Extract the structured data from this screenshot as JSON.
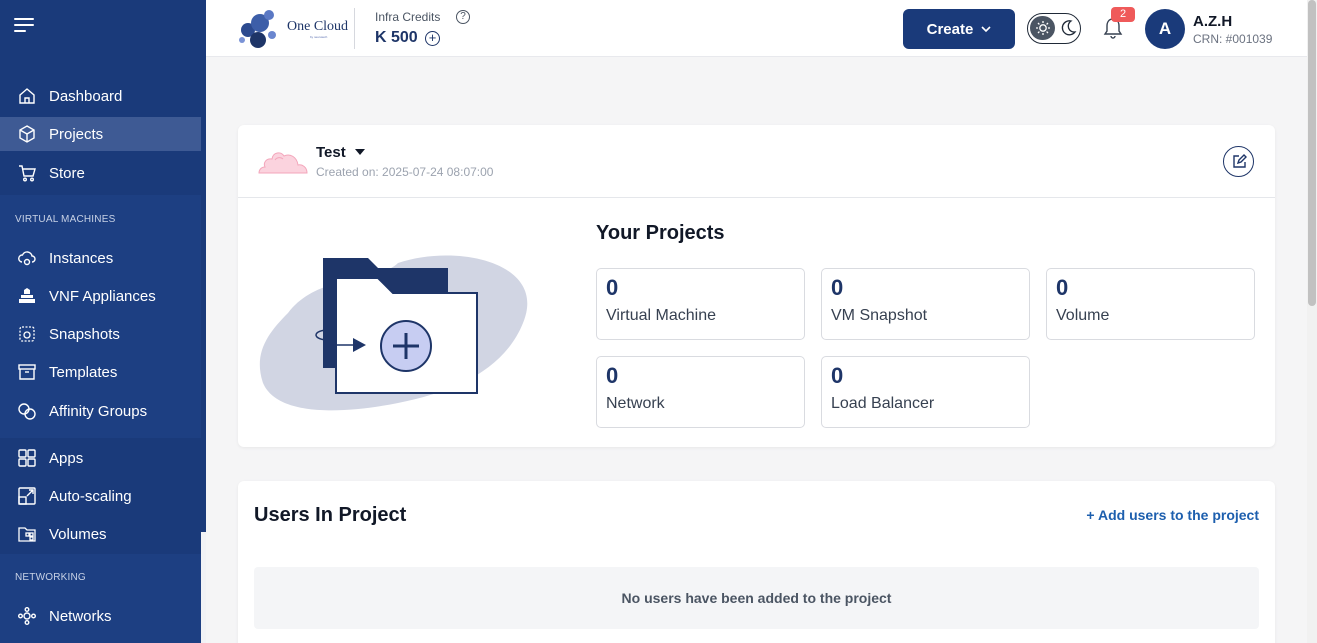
{
  "sidebar": {
    "items_top": [
      {
        "label": "Dashboard",
        "icon": "home-icon"
      },
      {
        "label": "Projects",
        "icon": "cube-icon",
        "active": true
      },
      {
        "label": "Store",
        "icon": "cart-icon"
      }
    ],
    "section_vm": "VIRTUAL MACHINES",
    "items_vm": [
      {
        "label": "Instances",
        "icon": "cloud-gear-icon"
      },
      {
        "label": "VNF Appliances",
        "icon": "firewall-icon"
      },
      {
        "label": "Snapshots",
        "icon": "camera-icon"
      },
      {
        "label": "Templates",
        "icon": "archive-box-icon"
      },
      {
        "label": "Affinity Groups",
        "icon": "affinity-icon"
      }
    ],
    "items_mid": [
      {
        "label": "Apps",
        "icon": "grid-icon"
      },
      {
        "label": "Auto-scaling",
        "icon": "resize-icon"
      },
      {
        "label": "Volumes",
        "icon": "folder-grid-icon"
      }
    ],
    "section_net": "NETWORKING",
    "items_net": [
      {
        "label": "Networks",
        "icon": "network-icon"
      }
    ]
  },
  "header": {
    "logo_text": "One Cloud",
    "logo_sub": "by neurotech",
    "credits_label": "Infra Credits",
    "credits_value": "K 500",
    "create_label": "Create",
    "notifications_count": "2",
    "avatar_initial": "A",
    "user_name": "A.Z.H",
    "user_crn": "CRN: #001039"
  },
  "project": {
    "name": "Test",
    "created": "Created on: 2025-07-24 08:07:00",
    "section_title": "Your Projects",
    "stats": [
      {
        "value": "0",
        "label": "Virtual Machine"
      },
      {
        "value": "0",
        "label": "VM Snapshot"
      },
      {
        "value": "0",
        "label": "Volume"
      },
      {
        "value": "0",
        "label": "Network"
      },
      {
        "value": "0",
        "label": "Load Balancer"
      }
    ]
  },
  "users": {
    "title": "Users In Project",
    "add_label": "+ Add users to the project",
    "empty_text": "No users have been added to the project"
  },
  "colors": {
    "primary": "#1a3a7a",
    "sidebar_active": "#3e5a94",
    "badge": "#ef5a5a",
    "link": "#1d5fae"
  }
}
